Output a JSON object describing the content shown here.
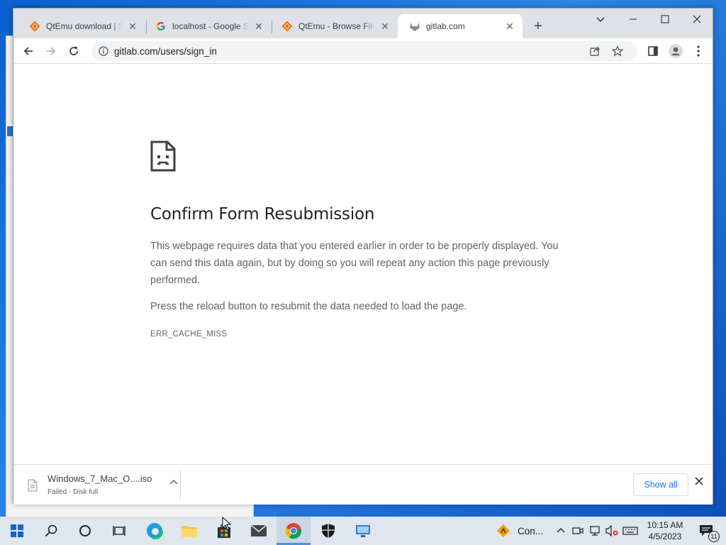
{
  "browser": {
    "tabs": [
      {
        "title": "QtEmu download | Sc",
        "favicon": "sourceforge-diamond-icon",
        "active": false
      },
      {
        "title": "localhost - Google Se",
        "favicon": "google-g-icon",
        "active": false
      },
      {
        "title": "QtEmu - Browse Files",
        "favicon": "sourceforge-diamond-icon",
        "active": false
      },
      {
        "title": "gitlab.com",
        "favicon": "gitlab-icon",
        "active": true
      }
    ],
    "new_tab_label": "+",
    "address": "gitlab.com/users/sign_in"
  },
  "error_page": {
    "title": "Confirm Form Resubmission",
    "body": "This webpage requires data that you entered earlier in order to be properly displayed. You can send this data again, but by doing so you will repeat any action this page previously performed.",
    "hint": "Press the reload button to resubmit the data needed to load the page.",
    "code": "ERR_CACHE_MISS"
  },
  "download_shelf": {
    "file_name": "Windows_7_Mac_O....iso",
    "status": "Failed - Disk full",
    "show_all_label": "Show all"
  },
  "taskbar": {
    "tray_app_label": "Con...",
    "time": "10:15 AM",
    "date": "4/5/2023",
    "notification_count": "11"
  },
  "colors": {
    "accent": "#1a73e8",
    "sourceforge": "#ff6600",
    "gitlab": "#8a8f94"
  }
}
